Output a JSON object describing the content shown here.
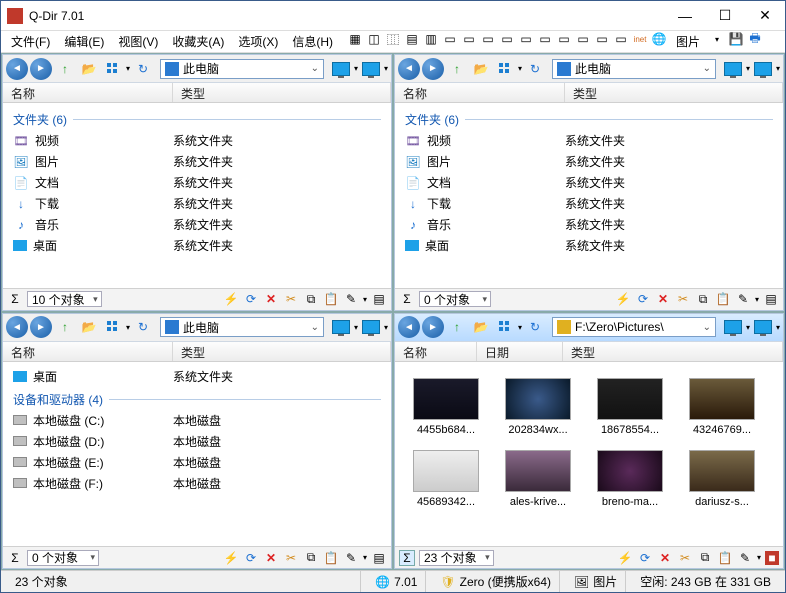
{
  "window": {
    "title": "Q-Dir 7.01"
  },
  "menu": [
    "文件(F)",
    "编辑(E)",
    "视图(V)",
    "收藏夹(A)",
    "选项(X)",
    "信息(H)"
  ],
  "menu_right_label": "图片",
  "cols": {
    "name": "名称",
    "type": "类型",
    "date": "日期"
  },
  "groups": {
    "folders": "文件夹 (6)",
    "drives": "设备和驱动器 (4)"
  },
  "system_folders": [
    {
      "icon": "video-icon",
      "cls": "ico-vid",
      "glyph": "🎞",
      "name": "视频",
      "type": "系统文件夹"
    },
    {
      "icon": "image-icon",
      "cls": "ico-img",
      "glyph": "🖼",
      "name": "图片",
      "type": "系统文件夹"
    },
    {
      "icon": "document-icon",
      "cls": "ico-doc",
      "glyph": "📄",
      "name": "文档",
      "type": "系统文件夹"
    },
    {
      "icon": "download-icon",
      "cls": "ico-dl",
      "glyph": "↓",
      "name": "下载",
      "type": "系统文件夹"
    },
    {
      "icon": "music-icon",
      "cls": "ico-mus",
      "glyph": "♪",
      "name": "音乐",
      "type": "系统文件夹"
    },
    {
      "icon": "desktop-icon",
      "cls": "ico-desk",
      "glyph": "",
      "name": "桌面",
      "type": "系统文件夹"
    }
  ],
  "pane3_desktop": {
    "name": "桌面",
    "type": "系统文件夹"
  },
  "drives": [
    {
      "name": "本地磁盘 (C:)",
      "type": "本地磁盘"
    },
    {
      "name": "本地磁盘 (D:)",
      "type": "本地磁盘"
    },
    {
      "name": "本地磁盘 (E:)",
      "type": "本地磁盘"
    },
    {
      "name": "本地磁盘 (F:)",
      "type": "本地磁盘"
    }
  ],
  "addr": {
    "this_pc": "此电脑",
    "pictures": "F:\\Zero\\Pictures\\"
  },
  "thumbs": [
    "4455b684...",
    "202834wx...",
    "18678554...",
    "43246769...",
    "45689342...",
    "ales-krive...",
    "breno-ma...",
    "dariusz-s..."
  ],
  "pane_status": {
    "p1": "10 个对象",
    "p2": "0 个对象",
    "p3": "0 个对象",
    "p4": "23 个对象"
  },
  "statusbar": {
    "objects": "23 个对象",
    "version": "7.01",
    "edition": "Zero (便携版x64)",
    "location": "图片",
    "space": "空闲: 243 GB 在 331 GB"
  }
}
